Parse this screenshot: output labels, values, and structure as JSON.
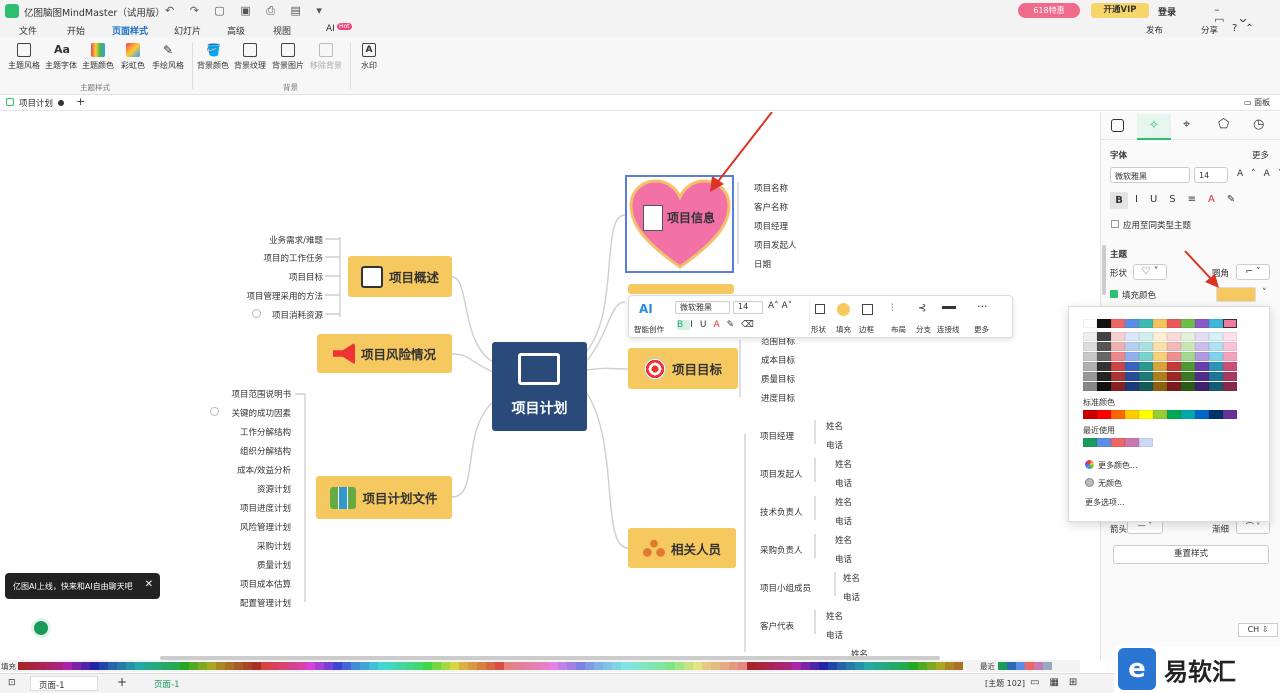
{
  "app": {
    "title": "亿图脑图MindMaster（试用版）",
    "promo_badge": "618特惠",
    "vip_label": "开通VIP",
    "login_label": "登录",
    "publish_label": "发布",
    "share_label": "分享"
  },
  "menu": {
    "items": [
      "文件",
      "开始",
      "页面样式",
      "幻灯片",
      "高级",
      "视图",
      "AI"
    ],
    "active": "页面样式",
    "ai_badge": "Hot"
  },
  "ribbon": {
    "groups": [
      {
        "label": "主题样式",
        "buttons": [
          "主题风格",
          "主题字体",
          "主题颜色",
          "彩虹色",
          "手绘风格"
        ]
      },
      {
        "label": "背景",
        "buttons": [
          "背景颜色",
          "背景纹理",
          "背景图片",
          "移除背景"
        ]
      },
      {
        "label": "",
        "buttons": [
          "水印"
        ]
      }
    ]
  },
  "doc_tab": {
    "name": "项目计划",
    "panel_toggle": "面板"
  },
  "mindmap": {
    "central": "项目计划",
    "nodes": {
      "overview": "项目概述",
      "risk": "项目风险情况",
      "docs": "项目计划文件",
      "info": "项目信息",
      "goal": "项目目标",
      "people": "相关人员"
    },
    "overview_leaves": [
      "业务需求/难题",
      "项目的工作任务",
      "项目目标",
      "项目管理采用的方法",
      "项目消耗资源"
    ],
    "docs_leaves": [
      "项目范围说明书",
      "关键的成功因素",
      "工作分解结构",
      "组织分解结构",
      "成本/效益分析",
      "资源计划",
      "项目进度计划",
      "风险管理计划",
      "采购计划",
      "质量计划",
      "项目成本估算",
      "配置管理计划"
    ],
    "info_leaves": [
      "项目名称",
      "客户名称",
      "项目经理",
      "项目发起人",
      "日期"
    ],
    "goal_leaves": [
      "范围目标",
      "成本目标",
      "质量目标",
      "进度目标"
    ],
    "people_groups": [
      {
        "role": "项目经理",
        "subs": [
          "姓名",
          "电话"
        ]
      },
      {
        "role": "项目发起人",
        "subs": [
          "姓名",
          "电话"
        ]
      },
      {
        "role": "技术负责人",
        "subs": [
          "姓名",
          "电话"
        ]
      },
      {
        "role": "采购负责人",
        "subs": [
          "姓名",
          "电话"
        ]
      },
      {
        "role": "项目小组成员",
        "subs": [
          "姓名",
          "电话"
        ]
      },
      {
        "role": "客户代表",
        "subs": [
          "姓名",
          "电话"
        ]
      }
    ],
    "partial_leaf": "姓名"
  },
  "float_toolbar": {
    "ai_label": "智能创作",
    "font": "微软雅黑",
    "size": "14",
    "tools": [
      "形状",
      "填充",
      "边框",
      "布局",
      "分支",
      "连接线",
      "更多"
    ]
  },
  "right_panel": {
    "font_section": "字体",
    "more": "更多",
    "font": "微软雅黑",
    "size": "14",
    "apply_same": "应用至同类型主题",
    "theme_section": "主题",
    "shape_label": "形状",
    "corner_label": "圆角",
    "fill_label": "填充颜色",
    "line_label": "箭头",
    "taper_label": "渐细",
    "reset_label": "重置样式"
  },
  "color_popup": {
    "standard_label": "标准颜色",
    "recent_label": "最近使用",
    "more_colors": "更多颜色...",
    "no_color": "无颜色",
    "more_options": "更多选项..."
  },
  "ai_tip": "亿图AI上线，快来和AI自由聊天吧",
  "status": {
    "page_tab": "页面-1",
    "page_tab2": "页面-1",
    "fill_label": "填充",
    "recent_label": "最近",
    "topic_count": "[主题 102]",
    "ime": "CH ⇩"
  },
  "colors": {
    "accent": "#2b6cb0",
    "node": "#f6c860",
    "central": "#2a4a7a",
    "heart": "#f272a8",
    "vip": "#f5d66b"
  }
}
